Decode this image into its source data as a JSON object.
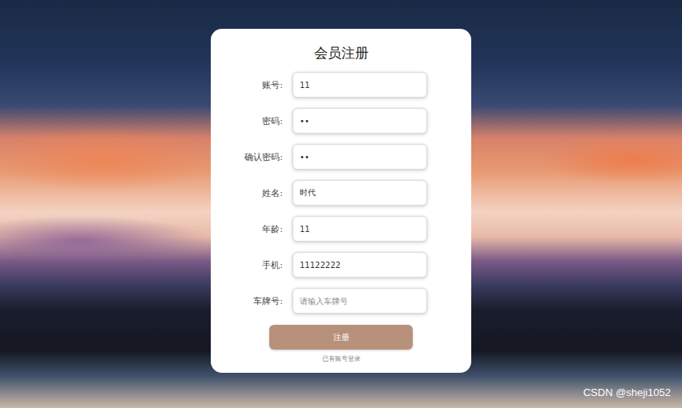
{
  "form": {
    "title": "会员注册",
    "fields": [
      {
        "label": "账号:",
        "value": "11",
        "placeholder": ""
      },
      {
        "label": "密码:",
        "value": "••",
        "placeholder": ""
      },
      {
        "label": "确认密码:",
        "value": "••",
        "placeholder": ""
      },
      {
        "label": "姓名:",
        "value": "时代",
        "placeholder": ""
      },
      {
        "label": "年龄:",
        "value": "11",
        "placeholder": ""
      },
      {
        "label": "手机:",
        "value": "11122222",
        "placeholder": ""
      },
      {
        "label": "车牌号:",
        "value": "",
        "placeholder": "请输入车牌号"
      }
    ],
    "submit_button": "注册",
    "login_link": "已有账号登录"
  },
  "watermark": "CSDN @sheji1052"
}
